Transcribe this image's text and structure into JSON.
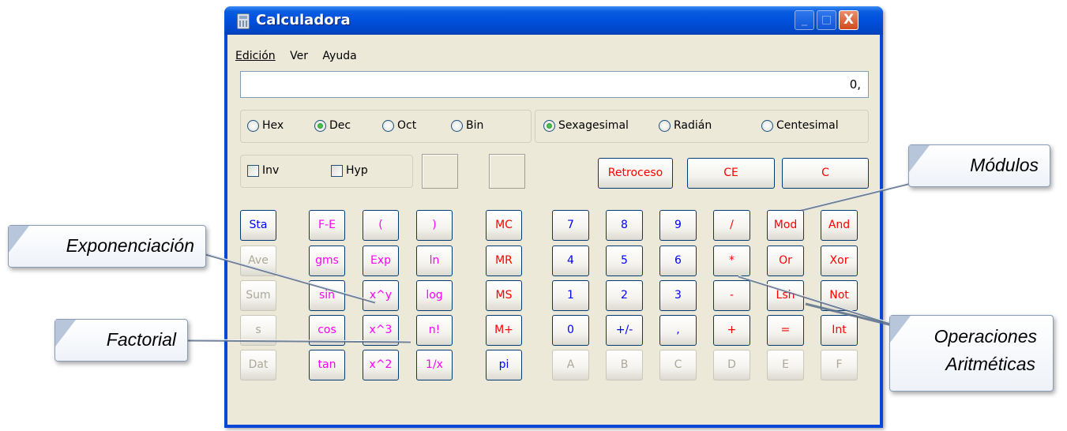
{
  "window": {
    "title": "Calculadora",
    "minimize_glyph": "_",
    "maximize_glyph": "□",
    "close_glyph": "X"
  },
  "menu": {
    "edicion": "Edición",
    "ver": "Ver",
    "ayuda": "Ayuda"
  },
  "display": {
    "value": "0,"
  },
  "number_system": {
    "hex": "Hex",
    "dec": "Dec",
    "oct": "Oct",
    "bin": "Bin",
    "selected": "Dec"
  },
  "angle_mode": {
    "sexagesimal": "Sexagesimal",
    "radian": "Radián",
    "centesimal": "Centesimal",
    "selected": "Sexagesimal"
  },
  "checks": {
    "inv": "Inv",
    "hyp": "Hyp"
  },
  "edit_buttons": {
    "retroceso": "Retroceso",
    "ce": "CE",
    "c": "C"
  },
  "sci_col1": [
    "Sta",
    "Ave",
    "Sum",
    "s",
    "Dat"
  ],
  "sci_col2": [
    "F-E",
    "gms",
    "sin",
    "cos",
    "tan"
  ],
  "sci_col3": [
    "(",
    "Exp",
    "x^y",
    "x^3",
    "x^2"
  ],
  "sci_col4": [
    ")",
    "ln",
    "log",
    "n!",
    "1/x"
  ],
  "memory": [
    "MC",
    "MR",
    "MS",
    "M+",
    "pi"
  ],
  "keypad_rows": [
    [
      "7",
      "8",
      "9",
      "/",
      "Mod",
      "And"
    ],
    [
      "4",
      "5",
      "6",
      "*",
      "Or",
      "Xor"
    ],
    [
      "1",
      "2",
      "3",
      "-",
      "Lsh",
      "Not"
    ],
    [
      "0",
      "+/-",
      ",",
      "+",
      "=",
      "Int"
    ],
    [
      "A",
      "B",
      "C",
      "D",
      "E",
      "F"
    ]
  ],
  "callouts": {
    "modulos": "Módulos",
    "exponenciacion": "Exponenciación",
    "factorial": "Factorial",
    "operaciones_line1": "Operaciones",
    "operaciones_line2": "Aritméticas"
  },
  "colors": {
    "title_blue": "#0050dd",
    "face": "#ece9d8",
    "key_blue": "#0000ff",
    "key_red": "#ff0000",
    "key_magenta": "#ff00ff"
  }
}
